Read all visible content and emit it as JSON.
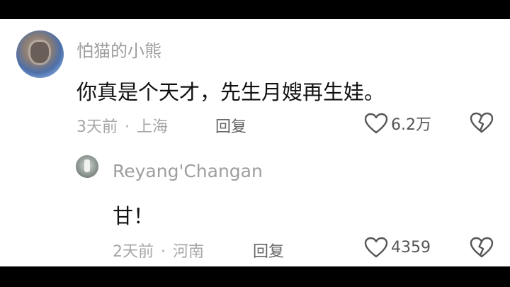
{
  "comment": {
    "username": "怕猫的小熊",
    "text": "你真是个天才，先生月嫂再生娃。",
    "time": "3天前",
    "location": "上海",
    "reply_label": "回复",
    "likes": "6.2万"
  },
  "reply": {
    "username": "Reyang'Changan",
    "text": "甘！",
    "time": "2天前",
    "location": "河南",
    "reply_label": "回复",
    "likes": "4359"
  },
  "separator": "·",
  "colors": {
    "letterbox": "#000000",
    "background": "#ffffff",
    "username": "#9e9e9e",
    "comment_text": "#111111",
    "meta_text": "#a6a6a6"
  },
  "icons": {
    "like": "heart-outline-icon",
    "dislike": "broken-heart-icon"
  }
}
